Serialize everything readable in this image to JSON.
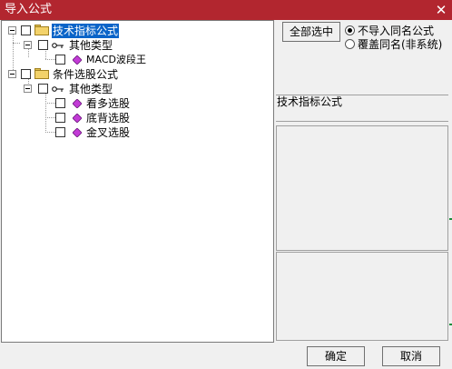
{
  "window": {
    "title": "导入公式",
    "close_symbol": "✕"
  },
  "tree": {
    "nodes": [
      {
        "label": "技术指标公式",
        "selected": true,
        "icon": "folder-icon"
      },
      {
        "label": "其他类型",
        "icon": "key-icon"
      },
      {
        "label": "MACD波段王",
        "icon": "diamond-icon"
      },
      {
        "label": "条件选股公式",
        "icon": "folder-icon"
      },
      {
        "label": "其他类型",
        "icon": "key-icon"
      },
      {
        "label": "看多选股",
        "icon": "diamond-icon"
      },
      {
        "label": "底背选股",
        "icon": "diamond-icon"
      },
      {
        "label": "金叉选股",
        "icon": "diamond-icon"
      }
    ]
  },
  "options": {
    "select_all_label": "全部选中",
    "radio_skip_label": "不导入同名公式",
    "radio_overwrite_label": "覆盖同名(非系统)",
    "selected": "skip"
  },
  "info": {
    "category_text": "技术指标公式"
  },
  "footer": {
    "ok_label": "确定",
    "cancel_label": "取消"
  },
  "colors": {
    "titlebar": "#b2262f",
    "selection": "#0a64c8",
    "accent_edge": "#1a8c3a"
  }
}
